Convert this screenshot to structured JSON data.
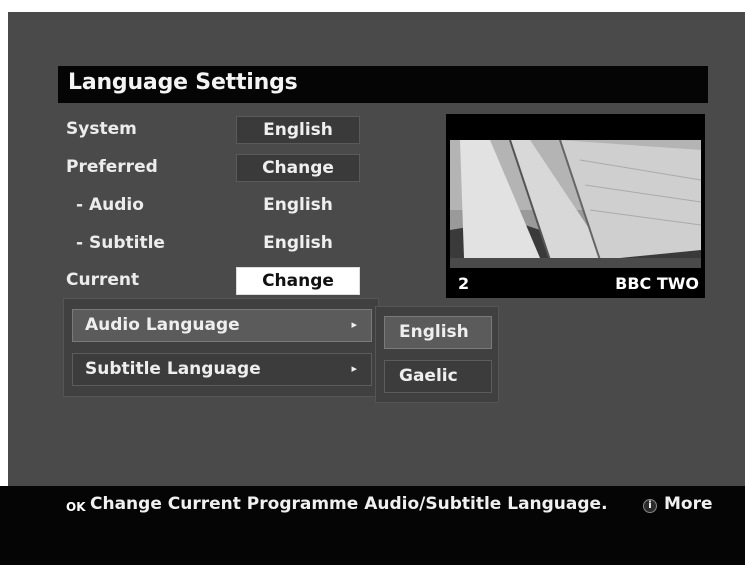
{
  "title": "Language Settings",
  "settings": {
    "system_label": "System",
    "system_value": "English",
    "preferred_label": "Preferred",
    "preferred_value": "Change",
    "audio_label": "- Audio",
    "audio_value": "English",
    "subtitle_label": "- Subtitle",
    "subtitle_value": "English",
    "current_label": "Current",
    "current_value": "Change"
  },
  "preview": {
    "channel_number": "2",
    "channel_name": "BBC TWO"
  },
  "submenu": {
    "items": [
      {
        "label": "Audio Language",
        "arrow": "▸"
      },
      {
        "label": "Subtitle Language",
        "arrow": "▸"
      }
    ]
  },
  "options": {
    "items": [
      {
        "label": "English"
      },
      {
        "label": "Gaelic"
      }
    ]
  },
  "footer": {
    "ok_key": "OK",
    "help_text": "Change Current Programme Audio/Subtitle Language.",
    "info_icon": "i",
    "more_label": "More"
  },
  "colors": {
    "background": "#4a4a4a",
    "bar": "#050505",
    "selected": "#ffffff"
  }
}
